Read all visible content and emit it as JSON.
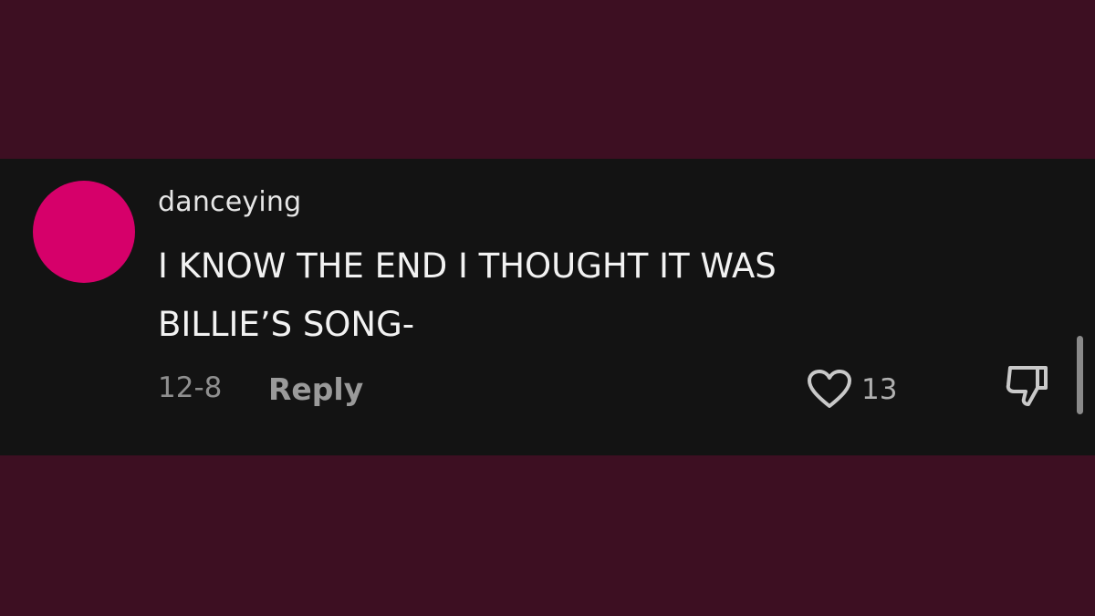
{
  "comment": {
    "username": "danceying",
    "text": "I KNOW THE END I THOUGHT IT WAS\nBILLIE’S SONG-",
    "date": "12-8",
    "reply_label": "Reply",
    "like_count": "13"
  },
  "colors": {
    "background": "#3d0f22",
    "card": "#131313",
    "avatar": "#d6006a"
  },
  "icons": {
    "like": "heart-outline-icon",
    "dislike": "thumbs-down-outline-icon"
  }
}
